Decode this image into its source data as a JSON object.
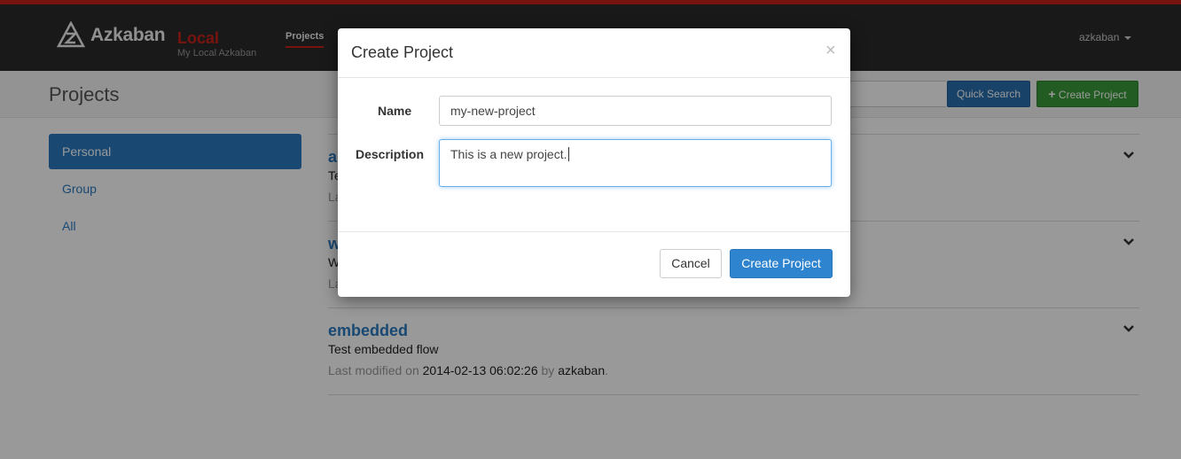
{
  "navbar": {
    "brand_name": "Azkaban",
    "brand_env": "Local",
    "brand_subtitle": "My Local Azkaban",
    "nav_projects": "Projects",
    "user": "azkaban"
  },
  "header": {
    "title": "Projects",
    "search_placeholder": "",
    "quick_search": "Quick Search",
    "create_project": "Create Project"
  },
  "sidebar": {
    "items": [
      {
        "label": "Personal",
        "active": true
      },
      {
        "label": "Group"
      },
      {
        "label": "All"
      }
    ]
  },
  "projects": [
    {
      "name": "a",
      "description": "Te",
      "meta_prefix": "La"
    },
    {
      "name": "w",
      "description": "W",
      "meta_prefix": "La"
    },
    {
      "name": "embedded",
      "description": "Test embedded flow",
      "meta_prefix": "Last modified on ",
      "date": "2014-02-13 06:02:26",
      "by": " by ",
      "user": "azkaban",
      "period": "."
    }
  ],
  "modal": {
    "title": "Create Project",
    "close": "×",
    "name_label": "Name",
    "name_value": "my-new-project",
    "description_label": "Description",
    "description_value": "This is a new project.",
    "cancel": "Cancel",
    "submit": "Create Project"
  },
  "colors": {
    "accent_red": "#c9221c",
    "link_blue": "#2a7ac0",
    "primary_button": "#2f84d0",
    "success_button": "#3a9a3a"
  }
}
